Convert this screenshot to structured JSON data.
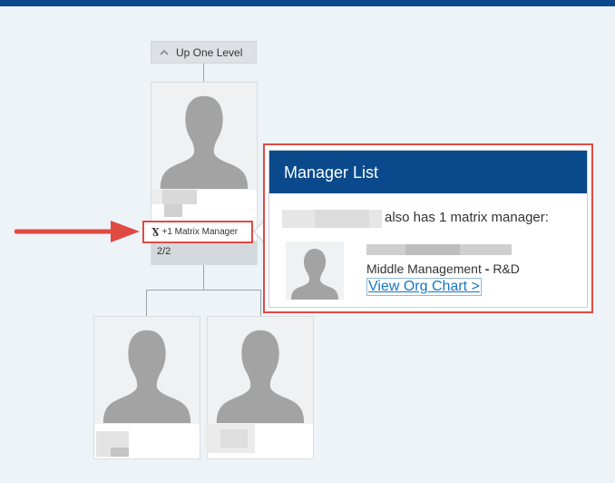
{
  "nav": {
    "up_one_level": "Up One Level"
  },
  "selected_person": {
    "matrix_badge": "+1 Matrix Manager",
    "count": "2/2"
  },
  "manager_list": {
    "title": "Manager List",
    "matrix_text": "also has 1 matrix manager:",
    "manager": {
      "title_role": "Middle Management",
      "title_sep": " - ",
      "title_dept": "R&D",
      "link": "View Org Chart >"
    }
  },
  "colors": {
    "brand": "#0a4a8c",
    "highlight": "#e04a43",
    "link": "#1576c2"
  }
}
